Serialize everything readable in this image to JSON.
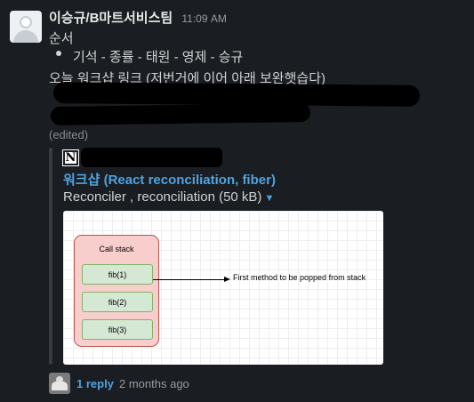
{
  "message": {
    "sender": "이승규/B마트서비스팀",
    "time": "11:09 AM",
    "lines": {
      "heading": "순서",
      "bullet": "기석 - 종률 - 태원 - 영제 - 승규",
      "workshop_intro": "오늘 워크샵 링크 (저번거에 이어 아래 보완햇습다)"
    },
    "edited_label": "(edited)"
  },
  "attachment": {
    "title": "워크샵 (React reconciliation, fiber)",
    "file_name": "Reconciler , reconciliation (50 kB)",
    "icon": "notion-icon",
    "diagram": {
      "stack_title": "Call stack",
      "frames": [
        "fib(1)",
        "fib(2)",
        "fib(3)"
      ],
      "arrow_label": "First method to be popped from stack"
    }
  },
  "thread": {
    "reply_count": "1 reply",
    "last_reply": "2 months ago"
  },
  "colors": {
    "background": "#1a1d21",
    "link": "#4fa3e0",
    "stack_fill": "#f8cecc",
    "frame_fill": "#d5e8d4"
  }
}
